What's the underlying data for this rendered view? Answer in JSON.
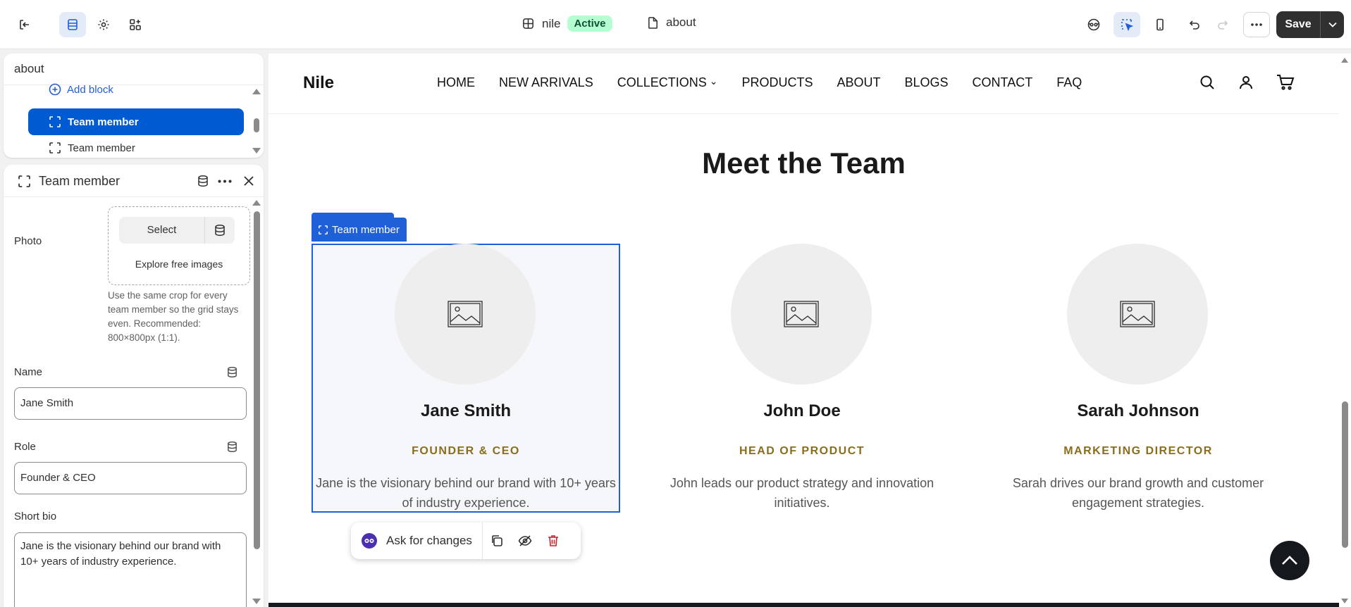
{
  "topbar": {
    "store_name": "nile",
    "status": "Active",
    "page_name": "about",
    "save_label": "Save"
  },
  "tree": {
    "title": "about",
    "add_block": "Add block",
    "items": [
      {
        "label": "Team member",
        "selected": true
      },
      {
        "label": "Team member",
        "selected": false
      }
    ]
  },
  "settings": {
    "title": "Team member",
    "photo_label": "Photo",
    "select_label": "Select",
    "explore_label": "Explore free images",
    "photo_help": "Use the same crop for every team member so the grid stays even. Recommended: 800×800px (1:1).",
    "name_label": "Name",
    "name_value": "Jane Smith",
    "role_label": "Role",
    "role_value": "Founder & CEO",
    "bio_label": "Short bio",
    "bio_value": "Jane is the visionary behind our brand with 10+ years of industry experience."
  },
  "site": {
    "logo": "Nile",
    "nav": [
      "HOME",
      "NEW ARRIVALS",
      "COLLECTIONS",
      "PRODUCTS",
      "ABOUT",
      "BLOGS",
      "CONTACT",
      "FAQ"
    ],
    "section_title": "Meet the Team",
    "selection_tag": "Team member",
    "members": [
      {
        "name": "Jane Smith",
        "role": "FOUNDER & CEO",
        "bio": "Jane is the visionary behind our brand with 10+ years of industry experience."
      },
      {
        "name": "John Doe",
        "role": "HEAD OF PRODUCT",
        "bio": "John leads our product strategy and innovation initiatives."
      },
      {
        "name": "Sarah Johnson",
        "role": "MARKETING DIRECTOR",
        "bio": "Sarah drives our brand growth and customer engagement strategies."
      }
    ],
    "ai_bar_label": "Ask for changes"
  },
  "colors": {
    "accent": "#1f5fd8",
    "selected_tree": "#005bd3",
    "role_gold": "#8a6d1e",
    "active_badge": "#b4fed2"
  }
}
